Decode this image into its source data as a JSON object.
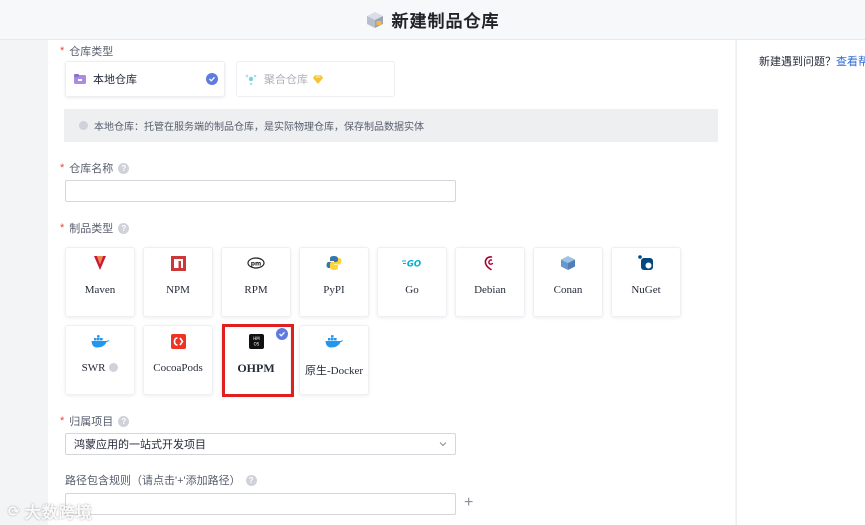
{
  "header": {
    "title": "新建制品仓库",
    "icon": "package-box-icon"
  },
  "help": {
    "text": "新建遇到问题？",
    "link": "查看帮助"
  },
  "repo_type": {
    "label": "仓库类型",
    "options": [
      {
        "label": "本地仓库",
        "icon": "local-repo-icon",
        "selected": true
      },
      {
        "label": "聚合仓库",
        "icon": "aggregate-repo-icon",
        "selected": false,
        "badge": "diamond-icon"
      }
    ],
    "description": "本地仓库：托管在服务端的制品仓库，是实际物理仓库，保存制品数据实体"
  },
  "repo_name": {
    "label": "仓库名称",
    "value": ""
  },
  "artifact_type": {
    "label": "制品类型",
    "items": [
      {
        "label": "Maven",
        "icon": "maven-icon",
        "color": "#c71a36"
      },
      {
        "label": "NPM",
        "icon": "npm-icon",
        "color": "#cb3837"
      },
      {
        "label": "RPM",
        "icon": "rpm-icon",
        "color": "#1a1a1a"
      },
      {
        "label": "PyPI",
        "icon": "python-icon",
        "color": "#3776ab"
      },
      {
        "label": "Go",
        "icon": "go-icon",
        "color": "#00add8"
      },
      {
        "label": "Debian",
        "icon": "debian-icon",
        "color": "#a80030"
      },
      {
        "label": "Conan",
        "icon": "conan-icon",
        "color": "#6699cb"
      },
      {
        "label": "NuGet",
        "icon": "nuget-icon",
        "color": "#004880"
      },
      {
        "label": "SWR",
        "icon": "docker-icon",
        "color": "#2496ed"
      },
      {
        "label": "CocoaPods",
        "icon": "cocoapods-icon",
        "color": "#ee3322"
      },
      {
        "label": "OHPM",
        "icon": "ohpm-icon",
        "color": "#111111",
        "selected": true
      },
      {
        "label": "原生-Docker",
        "icon": "docker-icon",
        "color": "#2496ed"
      }
    ]
  },
  "project": {
    "label": "归属项目",
    "value": "鸿蒙应用的一站式开发项目"
  },
  "path_rule": {
    "label": "路径包含规则（请点击'+'添加路径）",
    "value": ""
  },
  "watermark": {
    "text": "大数跨境"
  }
}
